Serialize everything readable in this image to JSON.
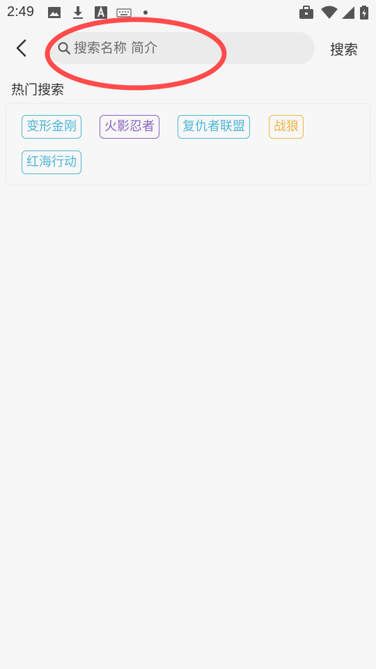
{
  "status_bar": {
    "time": "2:49",
    "icons": [
      "image-icon",
      "download-icon",
      "font-a-icon",
      "keyboard-icon",
      "dot-icon",
      "briefcase-icon",
      "wifi-icon",
      "signal-icon",
      "battery-icon"
    ]
  },
  "header": {
    "search_placeholder": "搜索名称 简介",
    "search_label": "搜索"
  },
  "hot_search": {
    "title": "热门搜索",
    "tags": [
      {
        "label": "变形金刚",
        "color": "#4fb6d6"
      },
      {
        "label": "火影忍者",
        "color": "#8a63c4"
      },
      {
        "label": "复仇者联盟",
        "color": "#4fb6d6"
      },
      {
        "label": "战狼",
        "color": "#f0b545"
      },
      {
        "label": "红海行动",
        "color": "#4fb6d6"
      }
    ]
  },
  "colors": {
    "annotation": "#ff4b4b",
    "background": "#f6f6f6"
  }
}
